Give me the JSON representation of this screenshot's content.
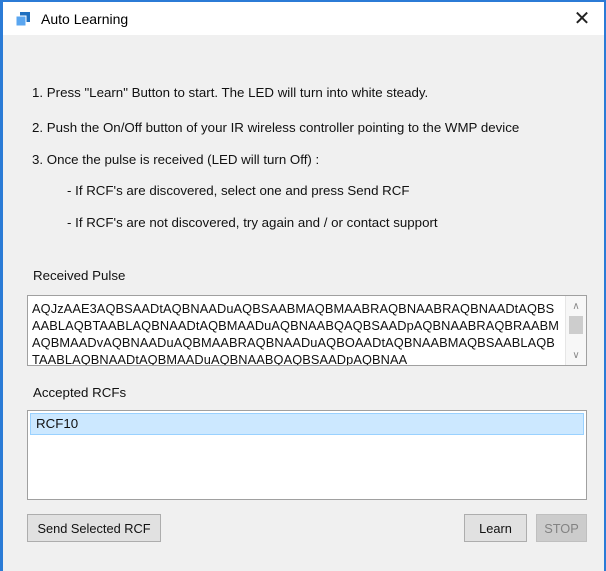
{
  "window": {
    "title": "Auto Learning",
    "close_symbol": "✕"
  },
  "instructions": [
    "1. Press \"Learn\" Button to start. The LED will turn into white steady.",
    "2. Push the On/Off button of your IR wireless controller pointing to the WMP device",
    "3. Once the pulse is received (LED will turn Off) :",
    "- If RCF's are discovered, select one and press Send RCF",
    "- If RCF's are not discovered, try again and / or contact support"
  ],
  "received_pulse": {
    "label": "Received Pulse",
    "value": "AQJzAAE3AQBSAADtAQBNAADuAQBSAABMAQBMAABRAQBNAABRAQBNAADtAQBSAABLAQBTAABLAQBNAADtAQBMAADuAQBNAABQAQBSAADpAQBNAABRAQBRAABMAQBMAADvAQBNAADuAQBMAABRAQBNAADuAQBOAADtAQBNAABMAQBSAABLAQBTAABLAQBNAADtAQBMAADuAQBNAABQAQBSAADpAQBNAA",
    "scroll_up_symbol": "∧",
    "scroll_down_symbol": "∨"
  },
  "accepted_rcfs": {
    "label": "Accepted RCFs",
    "items": [
      "RCF10"
    ],
    "selected_index": 0
  },
  "buttons": {
    "send_selected": "Send Selected RCF",
    "learn": "Learn",
    "stop": "STOP"
  },
  "colors": {
    "window_border": "#2b7bd6",
    "selection_bg": "#cce8ff",
    "selection_border": "#99d1ff"
  }
}
